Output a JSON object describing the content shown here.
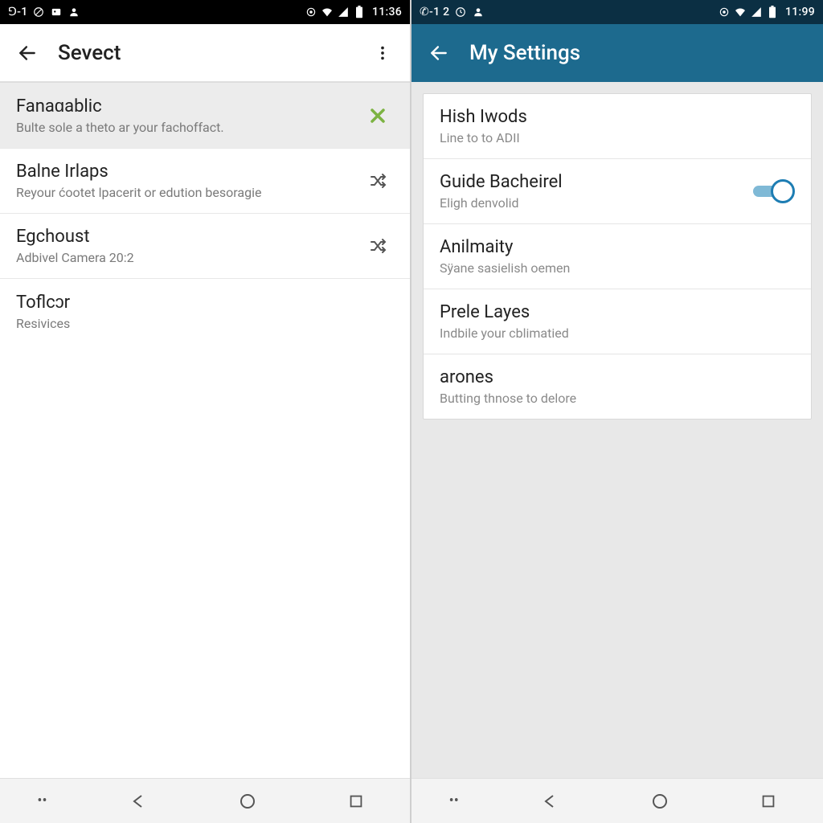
{
  "left": {
    "status": {
      "left_text": "⅁-1",
      "time": "11:36"
    },
    "appbar": {
      "title": "Sevect"
    },
    "items": [
      {
        "title": "Fanaɑablic",
        "subtitle": "Bulte sole a theto ar your fachoffact.",
        "icon": "check-green"
      },
      {
        "title": "Balne Irlaps",
        "subtitle": "Reyour ćootet lpacerit or edution besoragie",
        "icon": "shuffle"
      },
      {
        "title": "Egchoust",
        "subtitle": "Adbivel Camera 20:2",
        "icon": "shuffle"
      },
      {
        "title": "Toflcɔr",
        "subtitle": "Resivices",
        "icon": ""
      }
    ]
  },
  "right": {
    "status": {
      "left_text": "✆-1 2",
      "time": "11:99"
    },
    "appbar": {
      "title": "My Settings"
    },
    "items": [
      {
        "title": "Hish Iwods",
        "subtitle": "Line to to ADII",
        "control": ""
      },
      {
        "title": "Guide Bacheirel",
        "subtitle": "Eligh denvolid",
        "control": "toggle-on"
      },
      {
        "title": "Anilmaity",
        "subtitle": "Sÿane sasielish oemen",
        "control": ""
      },
      {
        "title": "Prele Layes",
        "subtitle": "Indbile your cblimatied",
        "control": ""
      },
      {
        "title": "arones",
        "subtitle": "Butting thnose to delore",
        "control": ""
      }
    ]
  }
}
